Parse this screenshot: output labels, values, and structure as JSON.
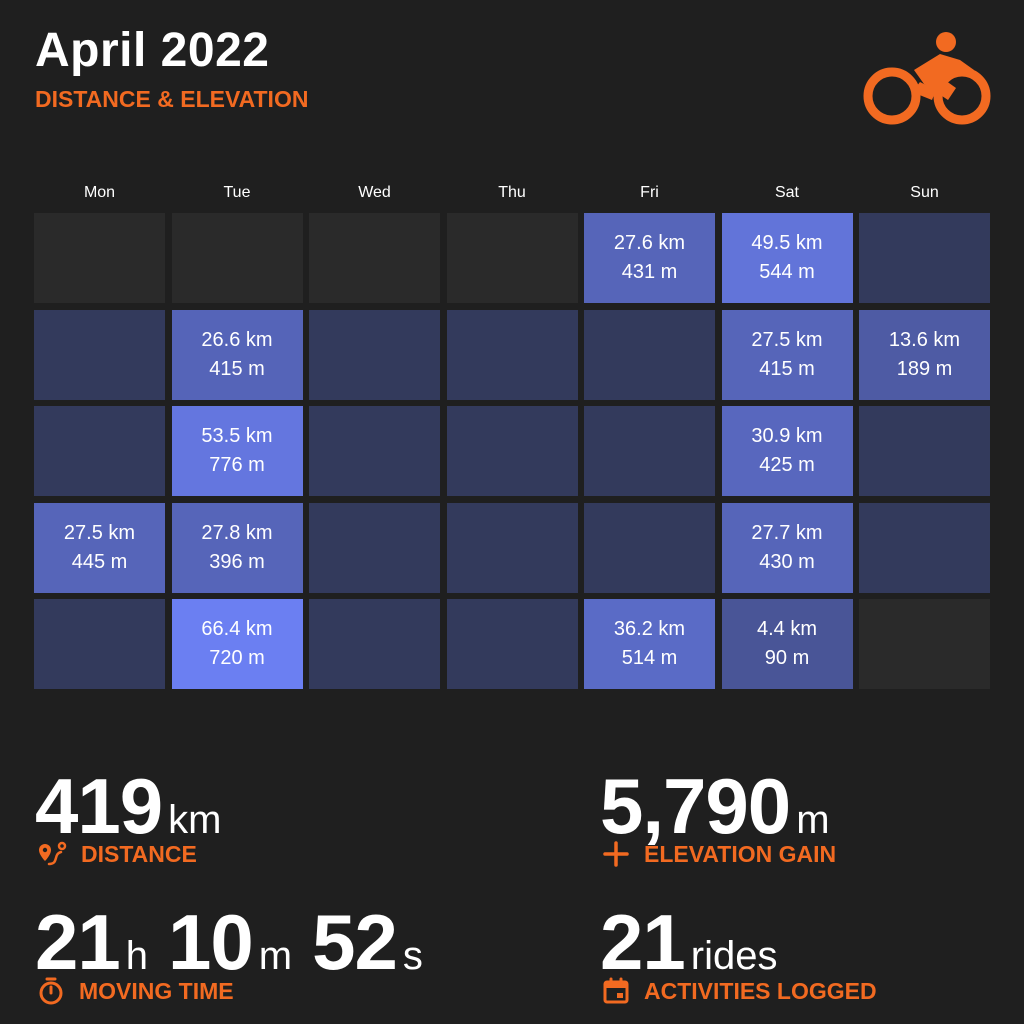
{
  "header": {
    "title": "April 2022",
    "subtitle": "DISTANCE & ELEVATION",
    "accent_color": "#f26a21",
    "logo_icon": "cyclist-icon"
  },
  "calendar": {
    "weekdays": [
      "Mon",
      "Tue",
      "Wed",
      "Thu",
      "Fri",
      "Sat",
      "Sun"
    ],
    "weeks": [
      [
        null,
        null,
        null,
        null,
        {
          "distance": "27.6 km",
          "elevation": "431 m",
          "km": 27.6
        },
        {
          "distance": "49.5 km",
          "elevation": "544 m",
          "km": 49.5
        },
        {
          "km": 0
        }
      ],
      [
        {
          "km": 0
        },
        {
          "distance": "26.6 km",
          "elevation": "415 m",
          "km": 26.6
        },
        {
          "km": 0
        },
        {
          "km": 0
        },
        {
          "km": 0
        },
        {
          "distance": "27.5 km",
          "elevation": "415 m",
          "km": 27.5
        },
        {
          "distance": "13.6 km",
          "elevation": "189 m",
          "km": 13.6
        }
      ],
      [
        {
          "km": 0
        },
        {
          "distance": "53.5 km",
          "elevation": "776 m",
          "km": 53.5
        },
        {
          "km": 0
        },
        {
          "km": 0
        },
        {
          "km": 0
        },
        {
          "distance": "30.9 km",
          "elevation": "425 m",
          "km": 30.9
        },
        {
          "km": 0
        }
      ],
      [
        {
          "distance": "27.5 km",
          "elevation": "445 m",
          "km": 27.5
        },
        {
          "distance": "27.8 km",
          "elevation": "396 m",
          "km": 27.8
        },
        {
          "km": 0
        },
        {
          "km": 0
        },
        {
          "km": 0
        },
        {
          "distance": "27.7 km",
          "elevation": "430 m",
          "km": 27.7
        },
        {
          "km": 0
        }
      ],
      [
        {
          "km": 0
        },
        {
          "distance": "66.4 km",
          "elevation": "720 m",
          "km": 66.4
        },
        {
          "km": 0
        },
        {
          "km": 0
        },
        {
          "distance": "36.2 km",
          "elevation": "514 m",
          "km": 36.2
        },
        {
          "distance": "4.4 km",
          "elevation": "90 m",
          "km": 4.4
        },
        null
      ]
    ]
  },
  "stats": {
    "distance": {
      "value": "419",
      "unit": "km",
      "label": "DISTANCE",
      "icon": "route-pin-icon"
    },
    "elevation": {
      "value": "5,790",
      "unit": "m",
      "label": "ELEVATION GAIN",
      "icon": "plus-icon"
    },
    "moving_time": {
      "hours": "21",
      "hours_unit": "h",
      "minutes": "10",
      "minutes_unit": "m",
      "seconds": "52",
      "seconds_unit": "s",
      "label": "MOVING TIME",
      "icon": "stopwatch-icon"
    },
    "activities": {
      "value": "21",
      "unit": "rides",
      "label": "ACTIVITIES LOGGED",
      "icon": "calendar-icon"
    }
  }
}
